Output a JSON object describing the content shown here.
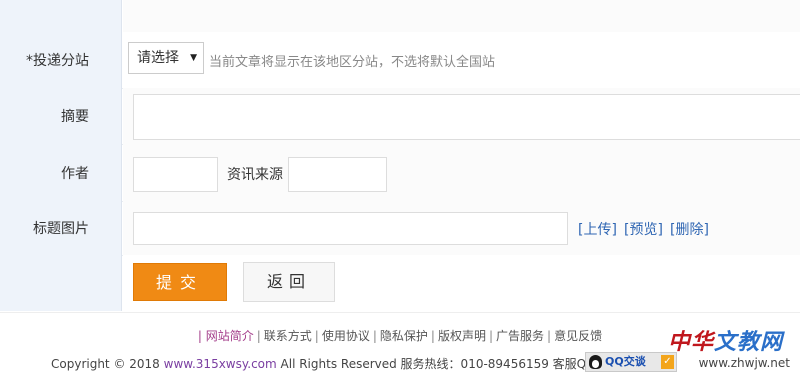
{
  "form": {
    "branch": {
      "label": "*投递分站",
      "select_value": "请选择",
      "hint": "当前文章将显示在该地区分站，不选将默认全国站"
    },
    "summary": {
      "label": "摘要",
      "value": ""
    },
    "author": {
      "label": "作者",
      "value": ""
    },
    "source": {
      "label": "资讯来源",
      "value": ""
    },
    "title_image": {
      "label": "标题图片",
      "value": "",
      "links": {
        "upload": "[上传]",
        "preview": "[预览]",
        "delete": "[删除]"
      }
    },
    "submit_label": "提交",
    "back_label": "返回"
  },
  "footer": {
    "links": [
      "| 网站简介",
      "联系方式",
      "使用协议",
      "隐私保护",
      "版权声明",
      "广告服务",
      "意见反馈"
    ],
    "copyright_prefix": "Copyright © 2018",
    "site": "www.315xwsy.com",
    "copyright_suffix": "All Rights Reserved 服务热线：010-89456159 客服QQ:",
    "qq_badge": "QQ交谈"
  },
  "watermark": {
    "brand_a": "中华",
    "brand_b": "文教网",
    "url": "www.zhwjw.net",
    "colors": {
      "brand_a": "#c0171d",
      "brand_b": "#2a6fc9"
    }
  },
  "colors": {
    "accent": "#f08a14",
    "label_bg": "#eef3fa",
    "link": "#2f66b3"
  }
}
